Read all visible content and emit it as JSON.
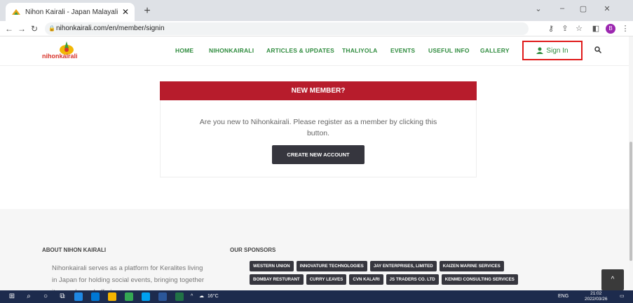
{
  "browser": {
    "tab_title": "Nihon Kairali - Japan Malayali (Ke",
    "tab_close": "✕",
    "new_tab": "+",
    "url": "nihonkairali.com/en/member/signin",
    "profile_initial": "B"
  },
  "site": {
    "logo_text": "nihonkairali",
    "nav": [
      "HOME",
      "NIHONKAIRALI",
      "ARTICLES & UPDATES",
      "THALIYOLA",
      "EVENTS",
      "USEFUL INFO",
      "GALLERY"
    ],
    "sign_in": "Sign In",
    "accent_green": "#2e8b3d",
    "accent_red": "#b71c2c"
  },
  "panel": {
    "heading": "NEW MEMBER?",
    "text": "Are you new to Nihonkairali. Please register as a member by clicking this button.",
    "button": "CREATE NEW ACCOUNT"
  },
  "footer": {
    "about_heading": "ABOUT NIHON KAIRALI",
    "about_text": "Nihonkairali serves as a platform for Keralites living in Japan for holding social events, bringing together its people, and offering",
    "sponsors_heading": "OUR SPONSORS",
    "sponsors": [
      "WESTERN UNION",
      "INNOVATURE TECHNOLOGIES",
      "JAY ENTERPRISES, LIMITED",
      "KAIZEN MARINE SERVICES",
      "BOMBAY RESTURANT",
      "CURRY LEAVES",
      "CVN KALARI",
      "JS TRADERS CO. LTD",
      "KENMEI CONSULTING SERVICES"
    ],
    "to_top": "^"
  },
  "taskbar": {
    "weather": "16°C",
    "lang": "ENG",
    "time": "21:02",
    "date": "2022/03/26"
  }
}
